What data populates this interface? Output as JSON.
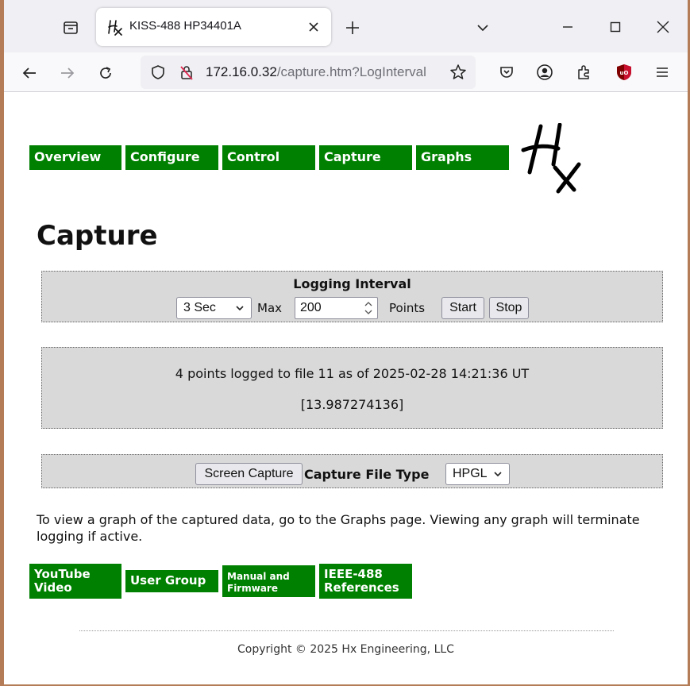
{
  "browser": {
    "tab_title": "KISS-488 HP34401A",
    "url_host": "172.16.0.32",
    "url_path": "/capture.htm?LogInterval"
  },
  "nav": {
    "items": [
      {
        "label": "Overview"
      },
      {
        "label": "Configure"
      },
      {
        "label": "Control"
      },
      {
        "label": "Capture"
      },
      {
        "label": "Graphs"
      }
    ]
  },
  "page": {
    "title": "Capture"
  },
  "logging": {
    "heading": "Logging Interval",
    "interval_value": "3 Sec",
    "max_label": "Max",
    "max_value": "200",
    "points_label": "Points",
    "start_label": "Start",
    "stop_label": "Stop"
  },
  "status": {
    "line1": "4 points logged to file 11 as of 2025-02-28 14:21:36 UT",
    "line2": "[13.987274136]"
  },
  "capture": {
    "button_label": "Screen Capture",
    "file_type_label": "Capture File Type",
    "file_type_value": "HPGL"
  },
  "info": {
    "text": "To view a graph of the captured data, go to the Graphs page. Viewing any graph will terminate logging if active."
  },
  "footer_links": {
    "youtube_line1": "YouTube",
    "youtube_line2": "Video",
    "user_group": "User Group",
    "manual_line1": "Manual and",
    "manual_line2": "Firmware",
    "ieee_line1": "IEEE-488",
    "ieee_line2": "References"
  },
  "copyright": "Copyright © 2025 Hx Engineering, LLC",
  "colors": {
    "menu_green": "#008000",
    "panel_gray": "#d9d9d9",
    "frame_brown": "#b47d57"
  }
}
